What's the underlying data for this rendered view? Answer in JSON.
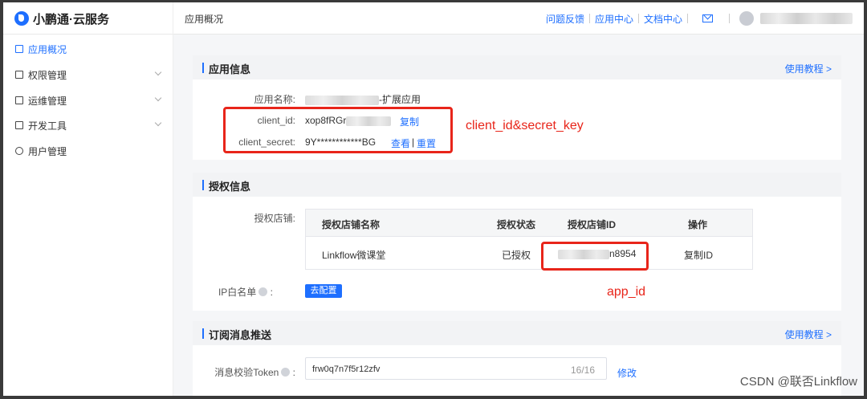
{
  "header": {
    "brand": "小鹏通·云服务",
    "breadcrumb": "应用概况",
    "links": [
      "问题反馈",
      "应用中心",
      "文档中心"
    ]
  },
  "sidebar": {
    "items": [
      {
        "label": "应用概况",
        "active": true
      },
      {
        "label": "权限管理",
        "expandable": true
      },
      {
        "label": "运维管理",
        "expandable": true
      },
      {
        "label": "开发工具",
        "expandable": true
      },
      {
        "label": "用户管理"
      }
    ]
  },
  "app_info": {
    "title": "应用信息",
    "tutorial": "使用教程 >",
    "name_label": "应用名称:",
    "name_suffix": "-扩展应用",
    "client_id_label": "client_id:",
    "client_id_prefix": "xop8fRGr",
    "copy": "复制",
    "secret_label": "client_secret:",
    "secret_value": "9Y************BG",
    "view": "查看",
    "divider": "|",
    "reset": "重置",
    "annotation": "client_id&secret_key"
  },
  "auth_info": {
    "title": "授权信息",
    "shop_label": "授权店铺:",
    "columns": [
      "授权店铺名称",
      "授权状态",
      "授权店铺ID",
      "操作"
    ],
    "rows": [
      {
        "name": "Linkflow微课堂",
        "status": "已授权",
        "id_suffix": "n8954",
        "action": "复制ID"
      }
    ],
    "ip_label": "IP白名单",
    "ip_colon": ":",
    "configure": "去配置",
    "annotation": "app_id"
  },
  "subscription": {
    "title": "订阅消息推送",
    "tutorial": "使用教程 >",
    "token_label": "消息校验Token",
    "token_colon": ":",
    "token_value": "frw0q7n7f5r12zfv",
    "token_count": "16/16",
    "modify": "修改"
  },
  "watermark": "CSDN @联否Linkflow",
  "colors": {
    "accent": "#1e6fff",
    "annotation": "#e8251a"
  }
}
